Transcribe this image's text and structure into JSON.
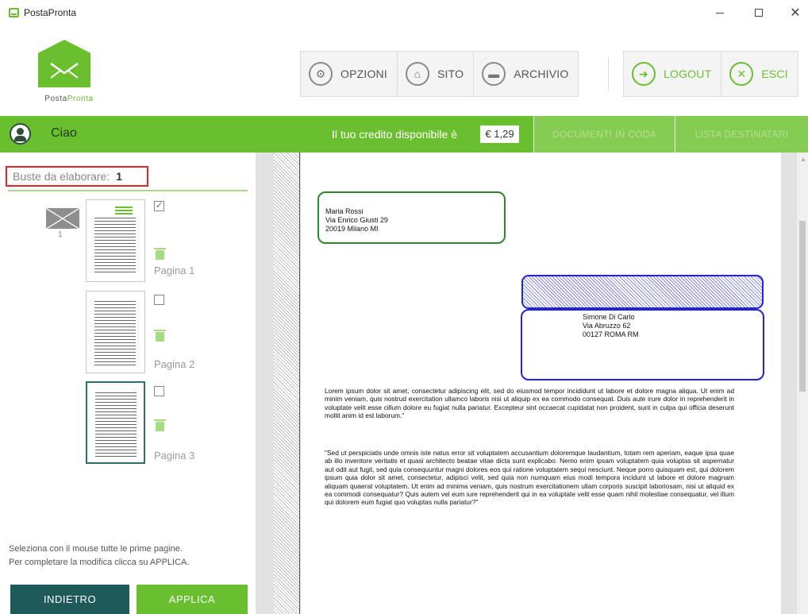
{
  "window": {
    "title": "PostaPronta",
    "min_glyph": "—",
    "close_glyph": "✕"
  },
  "logo": {
    "text_a": "Posta",
    "text_b": "Pronta"
  },
  "toolbar": {
    "opzioni_label": "OPZIONI",
    "sito_label": "SITO",
    "archivio_label": "ARCHIVIO",
    "logout_label": "LOGOUT",
    "esci_label": "ESCI",
    "opzioni_icon": "⚙",
    "sito_icon": "⌂",
    "archivio_icon": "▬",
    "logout_icon": "➜",
    "esci_icon": "✕"
  },
  "greenbar": {
    "greeting": "Ciao",
    "credit_label": "Il tuo credito disponibile è",
    "credit_value": "€ 1,29",
    "tab_docs": "DOCUMENTI IN CODA",
    "tab_dest": "LISTA DESTINATARI"
  },
  "left_panel": {
    "buste_label": "Buste da elaborare:",
    "buste_count": "1",
    "envelope_number": "1",
    "pages": [
      {
        "label": "Pagina 1",
        "checked": true,
        "check_glyph": "✓"
      },
      {
        "label": "Pagina 2",
        "checked": false,
        "check_glyph": ""
      },
      {
        "label": "Pagina 3",
        "checked": false,
        "check_glyph": ""
      }
    ],
    "hint_line1": "Seleziona con il mouse tutte le prime pagine.",
    "hint_line2": "Per completare la modifica clicca su APPLICA.",
    "back_label": "INDIETRO",
    "apply_label": "APPLICA"
  },
  "document": {
    "sender": [
      "Maria Rossi",
      "Via Enrico Giusti 29",
      "20019 Milano MI"
    ],
    "recipient": [
      "Simone Di Carlo",
      "Via Abruzzo 62",
      "00127 ROMA RM"
    ],
    "paragraph1": "Lorem ipsum dolor sit amet, consectetur adipiscing elit, sed do eiusmod tempor incididunt ut labore et dolore magna aliqua. Ut enim ad minim veniam, quis nostrud exercitation ullamco laboris nisi ut aliquip ex ea commodo consequat. Duis aute irure dolor in reprehenderit in voluptate velit esse cillum dolore eu fugiat nulla pariatur. Excepteur sint occaecat cupidatat non proident, sunt in culpa qui officia deserunt mollit anim id est laborum.\"",
    "paragraph2": "\"Sed ut perspiciatis unde omnis iste natus error sit voluptatem accusantium doloremque laudantium, totam rem aperiam, eaque ipsa quae ab illo inventore veritatis et quasi architecto beatae vitae dicta sunt explicabo. Nemo enim ipsam voluptatem quia voluptas sit aspernatur aut odit aut fugit, sed quia consequuntur magni dolores eos qui ratione voluptatem sequi nesciunt. Neque porro quisquam est, qui dolorem ipsum quia dolor sit amet, consectetur, adipisci velit, sed quia non numquam eius modi tempora incidunt ut labore et dolore magnam aliquam quaerat voluptatem. Ut enim ad minima veniam, quis nostrum exercitationem ullam corporis suscipit laboriosam, nisi ut aliquid ex ea commodi consequatur? Quis autem vel eum iure reprehenderit qui in ea voluptate velit esse quam nihil molestiae consequatur, vel illum qui dolorem eum fugiat quo voluptas nulla pariatur?\""
  },
  "colors": {
    "brand_green": "#6abf2e",
    "dark_teal": "#1e5a5a",
    "highlight_red": "#e4262a",
    "sender_border": "#2a8a2a",
    "recipient_border": "#2323d8"
  }
}
